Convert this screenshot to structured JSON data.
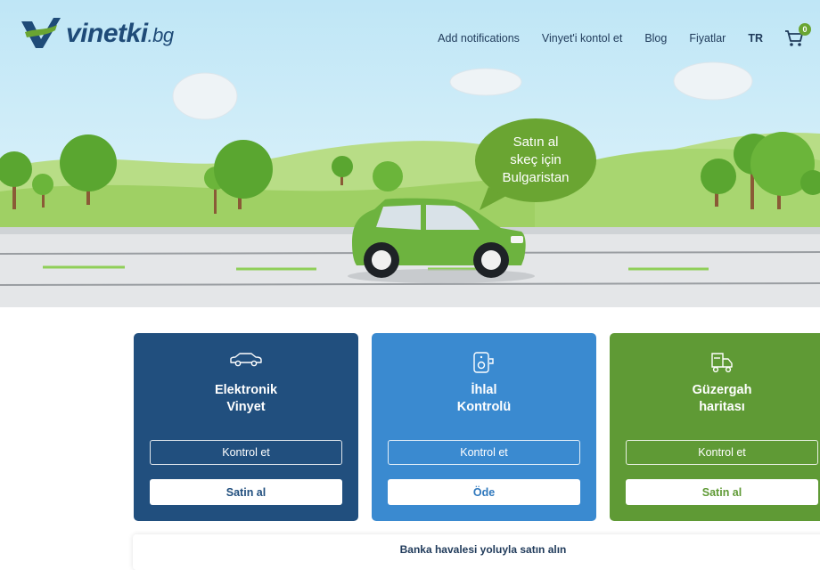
{
  "header": {
    "logo_text": "vinetki",
    "logo_tld": ".bg",
    "nav": [
      "Add notifications",
      "Vinyet'i kontol et",
      "Blog",
      "Fiyatlar"
    ],
    "language": "TR",
    "cart_count": "0"
  },
  "hero": {
    "bubble_lines": [
      "Satın al",
      "skeç için",
      "Bulgaristan"
    ]
  },
  "cards": [
    {
      "title_lines": [
        "Elektronik",
        "Vinyet"
      ],
      "outline_label": "Kontrol et",
      "solid_label": "Satin al",
      "color": "#214f7e",
      "icon": "car-icon"
    },
    {
      "title_lines": [
        "İhlal",
        "Kontrolü"
      ],
      "outline_label": "Kontrol et",
      "solid_label": "Öde",
      "color": "#3a8ad0",
      "icon": "camera-icon"
    },
    {
      "title_lines": [
        "Güzergah",
        "haritası"
      ],
      "outline_label": "Kontrol et",
      "solid_label": "Satin al",
      "color": "#5f9a35",
      "icon": "truck-icon"
    }
  ],
  "bank_transfer": "Banka havalesi yoluyla satın alın"
}
